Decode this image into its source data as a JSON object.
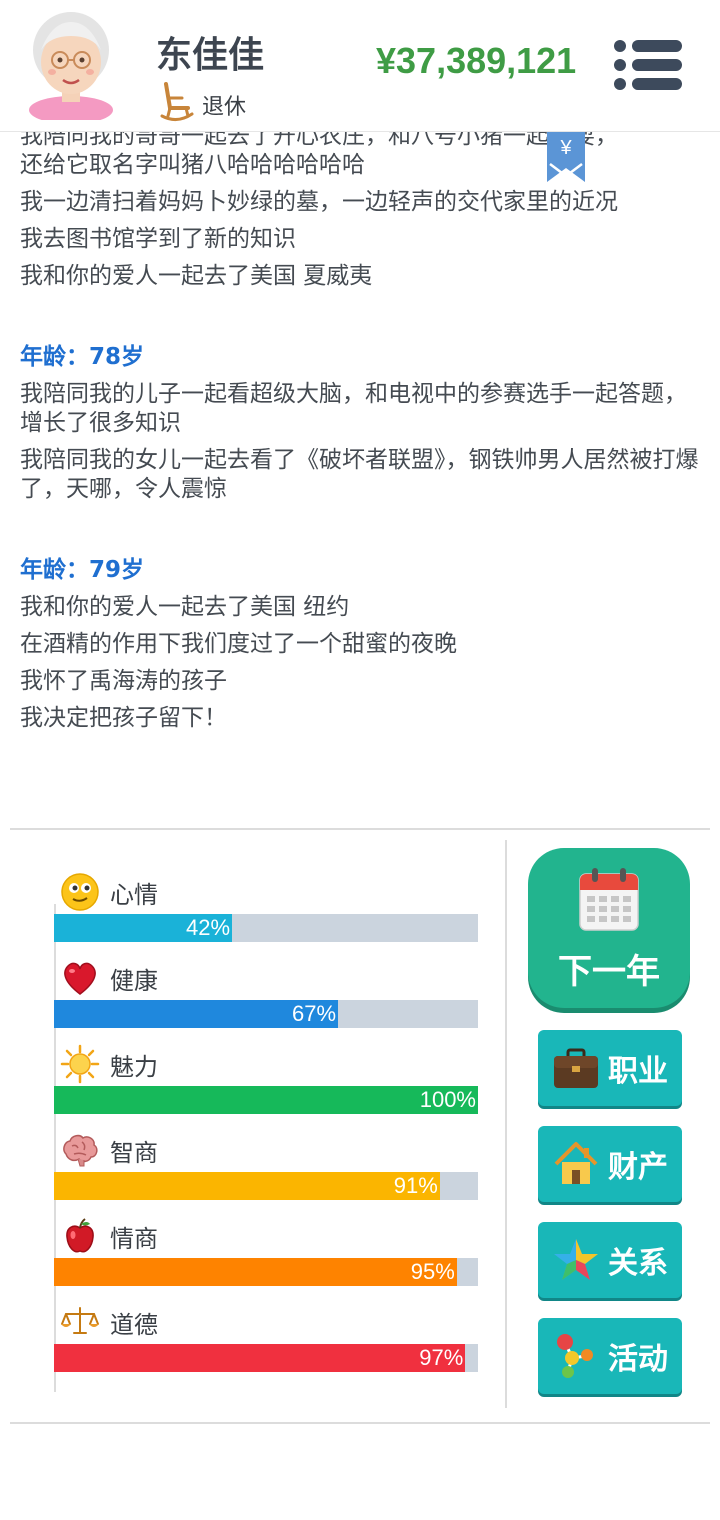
{
  "header": {
    "name": "东佳佳",
    "status": "退休",
    "money": "¥37,389,121"
  },
  "log": [
    {
      "type": "line",
      "text": "我陪同我的哥哥一起去了开心农庄，和八号小猪一起玩耍，"
    },
    {
      "type": "line",
      "text": "还给它取名字叫猪八哈哈哈哈哈哈"
    },
    {
      "type": "line",
      "text": "我一边清扫着妈妈卜妙绿的墓，一边轻声的交代家里的近况"
    },
    {
      "type": "line",
      "text": "我去图书馆学到了新的知识"
    },
    {
      "type": "line",
      "text": "我和你的爱人一起去了美国 夏威夷"
    },
    {
      "type": "age",
      "text": "年龄：78岁"
    },
    {
      "type": "line",
      "text": "我陪同我的儿子一起看超级大脑，和电视中的参赛选手一起答题，增长了很多知识"
    },
    {
      "type": "line",
      "text": "我陪同我的女儿一起去看了《破坏者联盟》，钢铁帅男人居然被打爆了，天哪，令人震惊"
    },
    {
      "type": "age",
      "text": "年龄：79岁"
    },
    {
      "type": "line",
      "text": "我和你的爱人一起去了美国 纽约"
    },
    {
      "type": "line",
      "text": "在酒精的作用下我们度过了一个甜蜜的夜晚"
    },
    {
      "type": "line",
      "text": "我怀了禹海涛的孩子"
    },
    {
      "type": "line",
      "text": "我决定把孩子留下！"
    }
  ],
  "bookmark_symbol": "¥",
  "stats": [
    {
      "name": "mood",
      "label": "心情",
      "value": 42,
      "pct_text": "42%",
      "color": "#1ab2d8",
      "icon": "smiley-icon"
    },
    {
      "name": "health",
      "label": "健康",
      "value": 67,
      "pct_text": "67%",
      "color": "#1f88dd",
      "icon": "heart-icon"
    },
    {
      "name": "charm",
      "label": "魅力",
      "value": 100,
      "pct_text": "100%",
      "color": "#16b95a",
      "icon": "sun-icon"
    },
    {
      "name": "iq",
      "label": "智商",
      "value": 91,
      "pct_text": "91%",
      "color": "#fbb500",
      "icon": "brain-icon"
    },
    {
      "name": "eq",
      "label": "情商",
      "value": 95,
      "pct_text": "95%",
      "color": "#fe8300",
      "icon": "apple-icon"
    },
    {
      "name": "morality",
      "label": "道德",
      "value": 97,
      "pct_text": "97%",
      "color": "#f0303f",
      "icon": "scales-icon"
    }
  ],
  "actions": {
    "next_year": "下一年",
    "career": "职业",
    "property": "财产",
    "relations": "关系",
    "activity": "活动"
  },
  "colors": {
    "money": "#3f9c45",
    "age_heading": "#1f6fd0",
    "next_button": "#22b48e",
    "action_button": "#19b7b8",
    "bar_track": "#cbd4de"
  }
}
